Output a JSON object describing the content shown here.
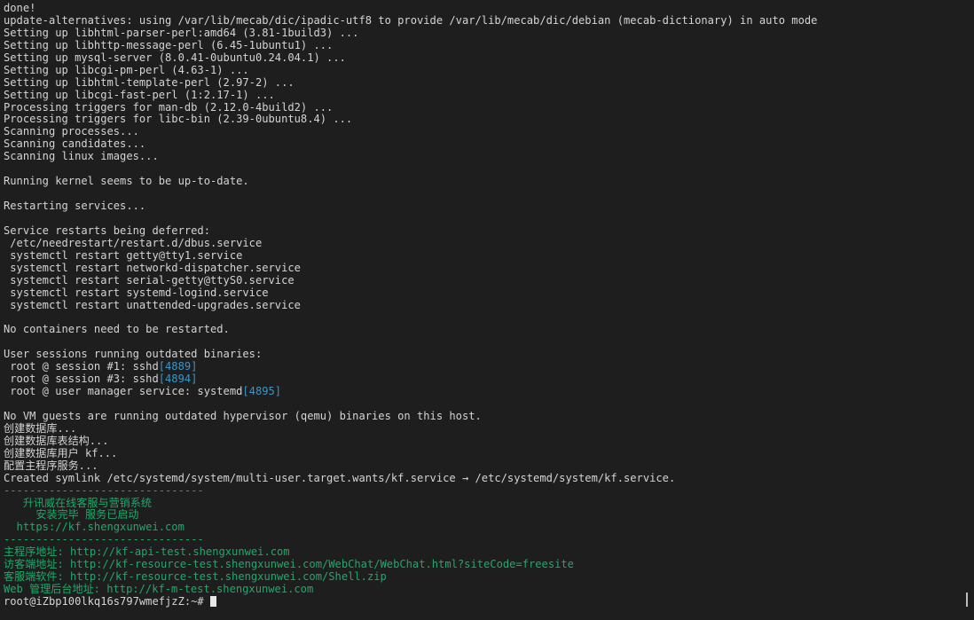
{
  "terminal": {
    "lines": [
      "done!",
      "update-alternatives: using /var/lib/mecab/dic/ipadic-utf8 to provide /var/lib/mecab/dic/debian (mecab-dictionary) in auto mode",
      "Setting up libhtml-parser-perl:amd64 (3.81-1build3) ...",
      "Setting up libhttp-message-perl (6.45-1ubuntu1) ...",
      "Setting up mysql-server (8.0.41-0ubuntu0.24.04.1) ...",
      "Setting up libcgi-pm-perl (4.63-1) ...",
      "Setting up libhtml-template-perl (2.97-2) ...",
      "Setting up libcgi-fast-perl (1:2.17-1) ...",
      "Processing triggers for man-db (2.12.0-4build2) ...",
      "Processing triggers for libc-bin (2.39-0ubuntu8.4) ...",
      "Scanning processes...",
      "Scanning candidates...",
      "Scanning linux images...",
      "",
      "Running kernel seems to be up-to-date.",
      "",
      "Restarting services...",
      "",
      "Service restarts being deferred:",
      " /etc/needrestart/restart.d/dbus.service",
      " systemctl restart getty@tty1.service",
      " systemctl restart networkd-dispatcher.service",
      " systemctl restart serial-getty@ttyS0.service",
      " systemctl restart systemd-logind.service",
      " systemctl restart unattended-upgrades.service",
      "",
      "No containers need to be restarted.",
      "",
      "User sessions running outdated binaries:",
      " root @ session #1: sshd",
      " root @ session #3: sshd",
      " root @ user manager service: systemd",
      "",
      "No VM guests are running outdated hypervisor (qemu) binaries on this host.",
      "创建数据库...",
      "创建数据库表结构...",
      "创建数据库用户 kf...",
      "配置主程序服务...",
      "Created symlink /etc/systemd/system/multi-user.target.wants/kf.service → /etc/systemd/system/kf.service.",
      "-------------------------------",
      "   升讯威在线客服与营销系统",
      "     安装完毕 服务已启动",
      "  https://kf.shengxunwei.com",
      "-------------------------------",
      "主程序地址: http://kf-api-test.shengxunwei.com",
      "访客端地址: http://kf-resource-test.shengxunwei.com/WebChat/WebChat.html?siteCode=freesite",
      "客服端软件: http://kf-resource-test.shengxunwei.com/Shell.zip",
      "Web 管理后台地址: http://kf-m-test.shengxunwei.com"
    ],
    "pids": {
      "29": "[4889]",
      "30": "[4894]",
      "31": "[4895]"
    },
    "green_from_line": 39,
    "prompt": "root@iZbp100lkq16s797wmefjzZ:~# ",
    "colors": {
      "background": "#1e1e1e",
      "text": "#d4d4d4",
      "pid": "#3a96c8",
      "green": "#1fa96b"
    }
  }
}
